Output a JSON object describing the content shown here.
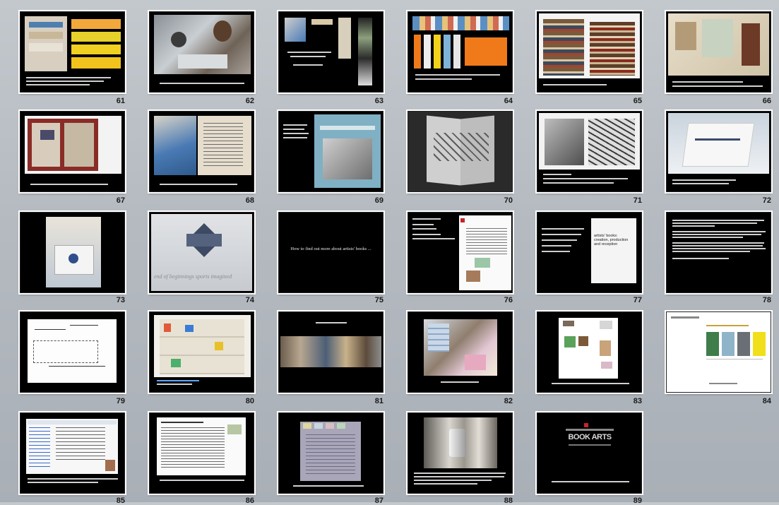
{
  "slide_sorter": {
    "slides": [
      {
        "number": "61"
      },
      {
        "number": "62"
      },
      {
        "number": "63"
      },
      {
        "number": "64"
      },
      {
        "number": "65"
      },
      {
        "number": "66"
      },
      {
        "number": "67"
      },
      {
        "number": "68"
      },
      {
        "number": "69"
      },
      {
        "number": "70"
      },
      {
        "number": "71"
      },
      {
        "number": "72"
      },
      {
        "number": "73"
      },
      {
        "number": "74"
      },
      {
        "number": "75"
      },
      {
        "number": "76"
      },
      {
        "number": "77"
      },
      {
        "number": "78"
      },
      {
        "number": "79"
      },
      {
        "number": "80"
      },
      {
        "number": "81"
      },
      {
        "number": "82"
      },
      {
        "number": "83"
      },
      {
        "number": "84"
      },
      {
        "number": "85"
      },
      {
        "number": "86"
      },
      {
        "number": "87"
      },
      {
        "number": "88"
      },
      {
        "number": "89"
      }
    ],
    "texts": {
      "slide_75_title": "How to find out more about artists' books ...",
      "slide_74_overlay": "end of beginnings    sports imagined",
      "slide_77_doc_title": "artists' books: creation, production and reception",
      "slide_89_logo": "BOOK ARTS"
    },
    "colors": {
      "background": "#b4bac0",
      "slide_fill": "#000000",
      "slide_frame": "#ffffff",
      "number_text": "#1a1a1a",
      "accent_orange": "#f07a1a",
      "accent_yellow": "#f2d21a"
    }
  }
}
